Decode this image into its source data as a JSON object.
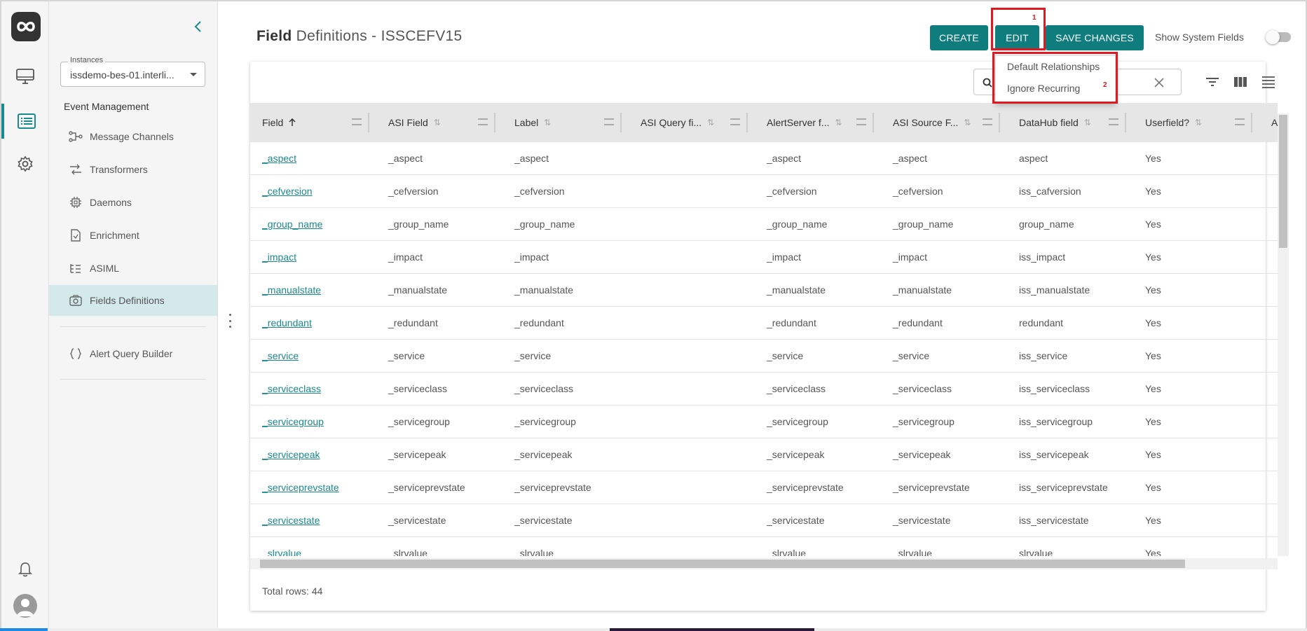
{
  "app": {
    "title_bold": "Field",
    "title_rest": "Definitions - ISSCEFV15"
  },
  "rail": {
    "icons": [
      "logo-icon",
      "monitor-icon",
      "list-icon",
      "gear-icon",
      "bell-icon",
      "user-avatar-icon"
    ],
    "active": "list-icon"
  },
  "sidebar": {
    "instances_label": "Instances",
    "instances_value": "issdemo-bes-01.interli...",
    "section_title": "Event Management",
    "items": [
      {
        "label": "Message Channels",
        "icon": "message-channels-icon"
      },
      {
        "label": "Transformers",
        "icon": "transformers-icon"
      },
      {
        "label": "Daemons",
        "icon": "daemons-icon"
      },
      {
        "label": "Enrichment",
        "icon": "enrichment-icon"
      },
      {
        "label": "ASIML",
        "icon": "asiml-icon"
      },
      {
        "label": "Fields Definitions",
        "icon": "fields-definitions-icon",
        "active": true
      }
    ],
    "extra_item": {
      "label": "Alert Query Builder",
      "icon": "braces-icon"
    }
  },
  "toolbar": {
    "create_label": "CREATE",
    "edit_label": "EDIT",
    "save_label": "SAVE CHANGES",
    "show_system_fields_label": "Show System Fields",
    "show_system_fields": false,
    "accent": "#0f7d7e"
  },
  "edit_menu": {
    "items": [
      "Default Relationships",
      "Ignore Recurring"
    ],
    "callout_1": "1",
    "callout_2": "2",
    "callout_color": "#e0181f"
  },
  "table": {
    "columns": [
      "Field",
      "ASI Field",
      "Label",
      "ASI Query fi...",
      "AlertServer f...",
      "ASI Source F...",
      "DataHub field",
      "Userfield?",
      "A"
    ],
    "sort_column": "Field",
    "sort_direction": "ascending",
    "rows": [
      [
        "_aspect",
        "_aspect",
        "_aspect",
        "",
        "_aspect",
        "_aspect",
        "aspect",
        "Yes"
      ],
      [
        "_cefversion",
        "_cefversion",
        "_cefversion",
        "",
        "_cefversion",
        "_cefversion",
        "iss_cafversion",
        "Yes"
      ],
      [
        "_group_name",
        "_group_name",
        "_group_name",
        "",
        "_group_name",
        "_group_name",
        "group_name",
        "Yes"
      ],
      [
        "_impact",
        "_impact",
        "_impact",
        "",
        "_impact",
        "_impact",
        "iss_impact",
        "Yes"
      ],
      [
        "_manualstate",
        "_manualstate",
        "_manualstate",
        "",
        "_manualstate",
        "_manualstate",
        "iss_manualstate",
        "Yes"
      ],
      [
        "_redundant",
        "_redundant",
        "_redundant",
        "",
        "_redundant",
        "_redundant",
        "redundant",
        "Yes"
      ],
      [
        "_service",
        "_service",
        "_service",
        "",
        "_service",
        "_service",
        "iss_service",
        "Yes"
      ],
      [
        "_serviceclass",
        "_serviceclass",
        "_serviceclass",
        "",
        "_serviceclass",
        "_serviceclass",
        "iss_serviceclass",
        "Yes"
      ],
      [
        "_servicegroup",
        "_servicegroup",
        "_servicegroup",
        "",
        "_servicegroup",
        "_servicegroup",
        "iss_servicegroup",
        "Yes"
      ],
      [
        "_servicepeak",
        "_servicepeak",
        "_servicepeak",
        "",
        "_servicepeak",
        "_servicepeak",
        "iss_servicepeak",
        "Yes"
      ],
      [
        "_serviceprevstate",
        "_serviceprevstate",
        "_serviceprevstate",
        "",
        "_serviceprevstate",
        "_serviceprevstate",
        "iss_serviceprevstate",
        "Yes"
      ],
      [
        "_servicestate",
        "_servicestate",
        "_servicestate",
        "",
        "_servicestate",
        "_servicestate",
        "iss_servicestate",
        "Yes"
      ],
      [
        "_slrvalue",
        "_slrvalue",
        "_slrvalue",
        "",
        "_slrvalue",
        "_slrvalue",
        "slrvalue",
        "Yes"
      ]
    ],
    "total_label": "Total rows:",
    "total_value": "44",
    "tools": [
      "filter-icon",
      "columns-icon",
      "density-icon"
    ]
  }
}
